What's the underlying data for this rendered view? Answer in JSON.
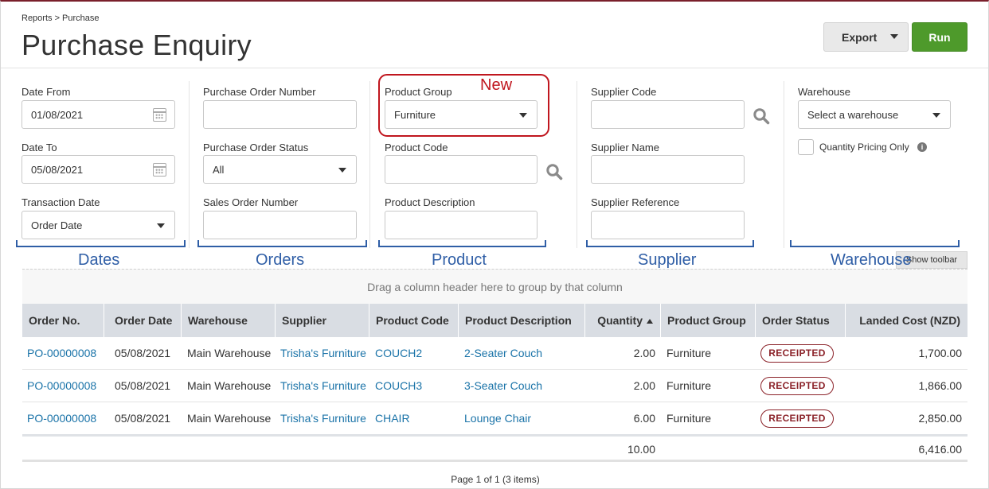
{
  "breadcrumb": "Reports > Purchase",
  "page_title": "Purchase Enquiry",
  "toolbar": {
    "export_label": "Export",
    "run_label": "Run"
  },
  "filters": {
    "date_from": {
      "label": "Date From",
      "value": "01/08/2021"
    },
    "date_to": {
      "label": "Date To",
      "value": "05/08/2021"
    },
    "transaction_date": {
      "label": "Transaction Date",
      "value": "Order Date"
    },
    "purchase_order_number": {
      "label": "Purchase Order Number",
      "value": ""
    },
    "purchase_order_status": {
      "label": "Purchase Order Status",
      "value": "All"
    },
    "sales_order_number": {
      "label": "Sales Order Number",
      "value": ""
    },
    "product_group": {
      "label": "Product Group",
      "value": "Furniture"
    },
    "product_code": {
      "label": "Product Code",
      "value": ""
    },
    "product_description": {
      "label": "Product Description",
      "value": ""
    },
    "supplier_code": {
      "label": "Supplier Code",
      "value": ""
    },
    "supplier_name": {
      "label": "Supplier Name",
      "value": ""
    },
    "supplier_reference": {
      "label": "Supplier Reference",
      "value": ""
    },
    "warehouse": {
      "label": "Warehouse",
      "placeholder": "Select a warehouse"
    },
    "quantity_pricing_only": {
      "label": "Quantity Pricing Only",
      "checked": false
    }
  },
  "annotations": {
    "new_label": "New",
    "color_new": "#c0161e",
    "color_groups": "#2f5ea6",
    "groups": [
      "Dates",
      "Orders",
      "Product",
      "Supplier",
      "Warehouse"
    ]
  },
  "grid": {
    "show_toolbar_label": "Show toolbar",
    "group_hint": "Drag a column header here to group by that column",
    "columns": [
      "Order No.",
      "Order Date",
      "Warehouse",
      "Supplier",
      "Product Code",
      "Product Description",
      "Quantity",
      "Product Group",
      "Order Status",
      "Landed Cost (NZD)"
    ],
    "sorted_column": "Quantity",
    "rows": [
      {
        "order_no": "PO-00000008",
        "order_date": "05/08/2021",
        "warehouse": "Main Warehouse",
        "supplier": "Trisha's Furniture",
        "product_code": "COUCH2",
        "product_description": "2-Seater Couch",
        "quantity": "2.00",
        "product_group": "Furniture",
        "order_status": "RECEIPTED",
        "landed_cost": "1,700.00"
      },
      {
        "order_no": "PO-00000008",
        "order_date": "05/08/2021",
        "warehouse": "Main Warehouse",
        "supplier": "Trisha's Furniture",
        "product_code": "COUCH3",
        "product_description": "3-Seater Couch",
        "quantity": "2.00",
        "product_group": "Furniture",
        "order_status": "RECEIPTED",
        "landed_cost": "1,866.00"
      },
      {
        "order_no": "PO-00000008",
        "order_date": "05/08/2021",
        "warehouse": "Main Warehouse",
        "supplier": "Trisha's Furniture",
        "product_code": "CHAIR",
        "product_description": "Lounge Chair",
        "quantity": "6.00",
        "product_group": "Furniture",
        "order_status": "RECEIPTED",
        "landed_cost": "2,850.00"
      }
    ],
    "totals": {
      "quantity": "10.00",
      "landed_cost": "6,416.00"
    },
    "pager": "Page 1 of 1 (3 items)"
  },
  "colors": {
    "accent": "#7a1f2b",
    "run": "#4e9a2b",
    "link": "#1a73a8",
    "status_badge": "#8b2229",
    "header_bg": "#d9dde3"
  }
}
